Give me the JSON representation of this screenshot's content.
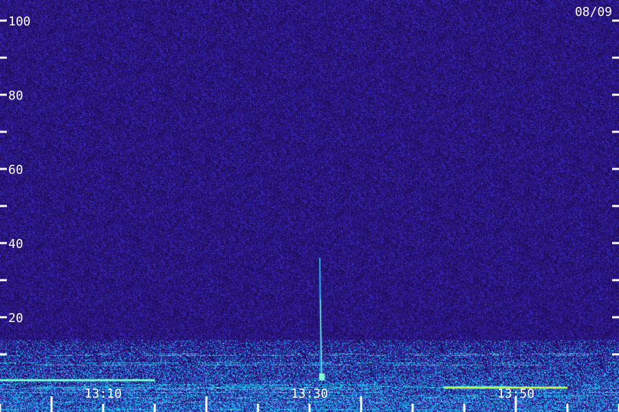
{
  "chart_data": {
    "type": "heatmap",
    "title": "",
    "xlabel": "",
    "ylabel": "",
    "date_label": "08/09",
    "ylim": [
      0,
      100
    ],
    "y_major_ticks": [
      20,
      40,
      60,
      80,
      100
    ],
    "y_minor_ticks": [
      10,
      30,
      50,
      70,
      90
    ],
    "y_tick_labels": [
      "20",
      "40",
      "60",
      "80",
      "100"
    ],
    "xlim": [
      "13:00",
      "14:00"
    ],
    "x_tick_labels": [
      "13:10",
      "13:30",
      "13:50"
    ],
    "x_major_ticks": [
      "13:05",
      "13:20",
      "13:35",
      "13:50"
    ],
    "x_minor_ticks": [
      "13:00",
      "13:10",
      "13:15",
      "13:25",
      "13:30",
      "13:40",
      "13:45",
      "13:55",
      "14:00"
    ],
    "grid": false,
    "colors": {
      "background": "#1a0a4a",
      "noise_low": "#2a1480",
      "noise_mid": "#3b2fd0",
      "signal": "#29b6f6",
      "strong": "#7fffd4",
      "peak": "#b7ff3f",
      "text": "#ffffff"
    },
    "features": [
      {
        "kind": "impulse",
        "time": "13:31",
        "y_from": 0,
        "y_to": 36
      },
      {
        "kind": "band",
        "time_from": "13:00",
        "time_to": "14:00",
        "y_from": 0,
        "y_to": 14
      },
      {
        "kind": "line",
        "time_from": "13:00",
        "time_to": "13:15",
        "y": 3
      },
      {
        "kind": "line",
        "time_from": "13:43",
        "time_to": "13:55",
        "y": 1
      }
    ]
  }
}
